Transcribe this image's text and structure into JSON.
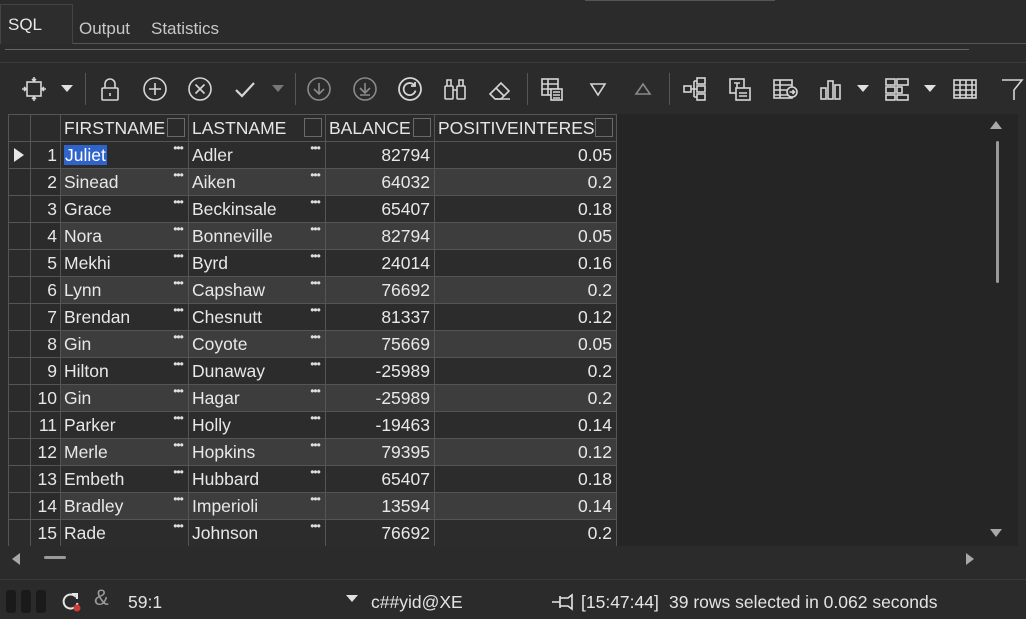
{
  "tabs": [
    {
      "label": "SQL",
      "active": true
    },
    {
      "label": "Output",
      "active": false
    },
    {
      "label": "Statistics",
      "active": false
    }
  ],
  "toolbar": {
    "icons": [
      "freeze-view-icon",
      "lock-icon",
      "add-row-icon",
      "delete-row-icon",
      "commit-check-icon",
      "import-icon",
      "export-icon",
      "refresh-icon",
      "binoculars-icon",
      "eraser-icon",
      "grid-columns-icon",
      "sort-descending-icon",
      "sort-ascending-icon",
      "tree-icon",
      "text-export-icon",
      "table-export-icon",
      "bar-chart-icon",
      "pivot-icon",
      "table-view-icon",
      "filter-icon"
    ]
  },
  "grid": {
    "columns": [
      "FIRSTNAME",
      "LASTNAME",
      "BALANCE",
      "POSITIVEINTEREST"
    ],
    "rows": [
      {
        "n": "1",
        "first": "Juliet",
        "last": "Adler",
        "balance": "82794",
        "interest": "0.05"
      },
      {
        "n": "2",
        "first": "Sinead",
        "last": "Aiken",
        "balance": "64032",
        "interest": "0.2"
      },
      {
        "n": "3",
        "first": "Grace",
        "last": "Beckinsale",
        "balance": "65407",
        "interest": "0.18"
      },
      {
        "n": "4",
        "first": "Nora",
        "last": "Bonneville",
        "balance": "82794",
        "interest": "0.05"
      },
      {
        "n": "5",
        "first": "Mekhi",
        "last": "Byrd",
        "balance": "24014",
        "interest": "0.16"
      },
      {
        "n": "6",
        "first": "Lynn",
        "last": "Capshaw",
        "balance": "76692",
        "interest": "0.2"
      },
      {
        "n": "7",
        "first": "Brendan",
        "last": "Chesnutt",
        "balance": "81337",
        "interest": "0.12"
      },
      {
        "n": "8",
        "first": "Gin",
        "last": "Coyote",
        "balance": "75669",
        "interest": "0.05"
      },
      {
        "n": "9",
        "first": "Hilton",
        "last": "Dunaway",
        "balance": "-25989",
        "interest": "0.2"
      },
      {
        "n": "10",
        "first": "Gin",
        "last": "Hagar",
        "balance": "-25989",
        "interest": "0.2"
      },
      {
        "n": "11",
        "first": "Parker",
        "last": "Holly",
        "balance": "-19463",
        "interest": "0.14"
      },
      {
        "n": "12",
        "first": "Merle",
        "last": "Hopkins",
        "balance": "79395",
        "interest": "0.12"
      },
      {
        "n": "13",
        "first": "Embeth",
        "last": "Hubbard",
        "balance": "65407",
        "interest": "0.18"
      },
      {
        "n": "14",
        "first": "Bradley",
        "last": "Imperioli",
        "balance": "13594",
        "interest": "0.14"
      },
      {
        "n": "15",
        "first": "Rade",
        "last": "Johnson",
        "balance": "76692",
        "interest": "0.2"
      }
    ],
    "selected_cell_value": "Juliet"
  },
  "status": {
    "cursor_position": "59:1",
    "connection": "c##yid@XE",
    "time": "[15:47:44]",
    "message": "39 rows selected in 0.062 seconds"
  },
  "colors": {
    "background": "#2b2b2b",
    "row_odd": "#2c2c2c",
    "row_even": "#3d3d3d",
    "selection": "#2f65ca"
  }
}
